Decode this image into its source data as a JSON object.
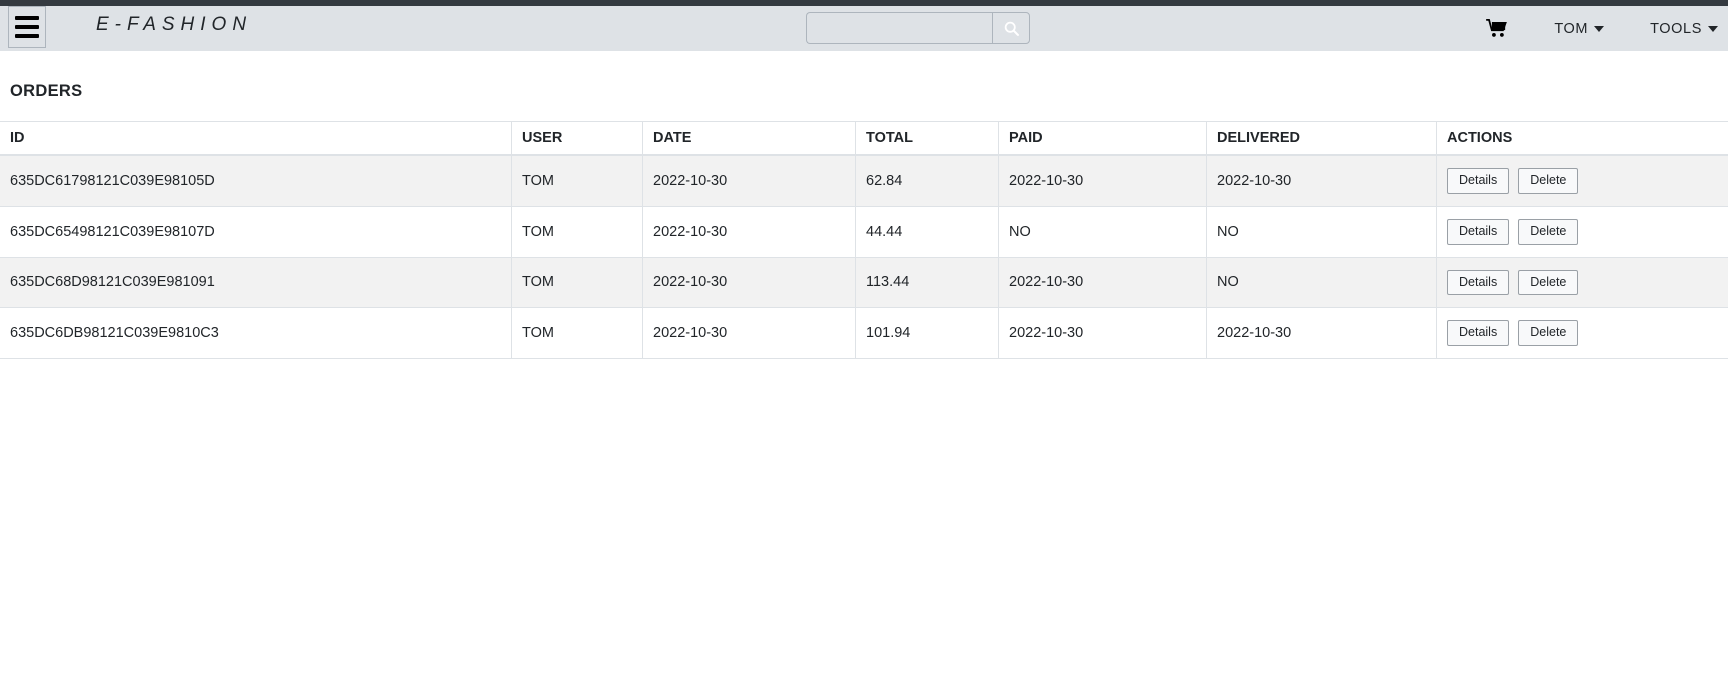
{
  "navbar": {
    "menu_icon": "hamburger-icon",
    "brand": "E-FASHION",
    "search": {
      "value": "",
      "placeholder": "",
      "button_icon": "search-icon"
    },
    "cart_icon": "shopping-cart-icon",
    "user_menu": "TOM",
    "tools_menu": "TOOLS"
  },
  "main": {
    "title": "ORDERS",
    "table": {
      "headers": [
        "ID",
        "USER",
        "DATE",
        "TOTAL",
        "PAID",
        "DELIVERED",
        "ACTIONS"
      ],
      "rows": [
        {
          "id": "635DC61798121C039E98105D",
          "user": "TOM",
          "date": "2022-10-30",
          "total": "62.84",
          "paid": "2022-10-30",
          "delivered": "2022-10-30"
        },
        {
          "id": "635DC65498121C039E98107D",
          "user": "TOM",
          "date": "2022-10-30",
          "total": "44.44",
          "paid": "NO",
          "delivered": "NO"
        },
        {
          "id": "635DC68D98121C039E981091",
          "user": "TOM",
          "date": "2022-10-30",
          "total": "113.44",
          "paid": "2022-10-30",
          "delivered": "NO"
        },
        {
          "id": "635DC6DB98121C039E9810C3",
          "user": "TOM",
          "date": "2022-10-30",
          "total": "101.94",
          "paid": "2022-10-30",
          "delivered": "2022-10-30"
        }
      ],
      "details_label": "Details",
      "delete_label": "Delete"
    }
  },
  "colors": {
    "top_strip": "#343a40",
    "navbar_bg": "#dee2e6",
    "row_striped": "#f2f2f2",
    "border": "#dee2e6",
    "text": "#212529"
  }
}
